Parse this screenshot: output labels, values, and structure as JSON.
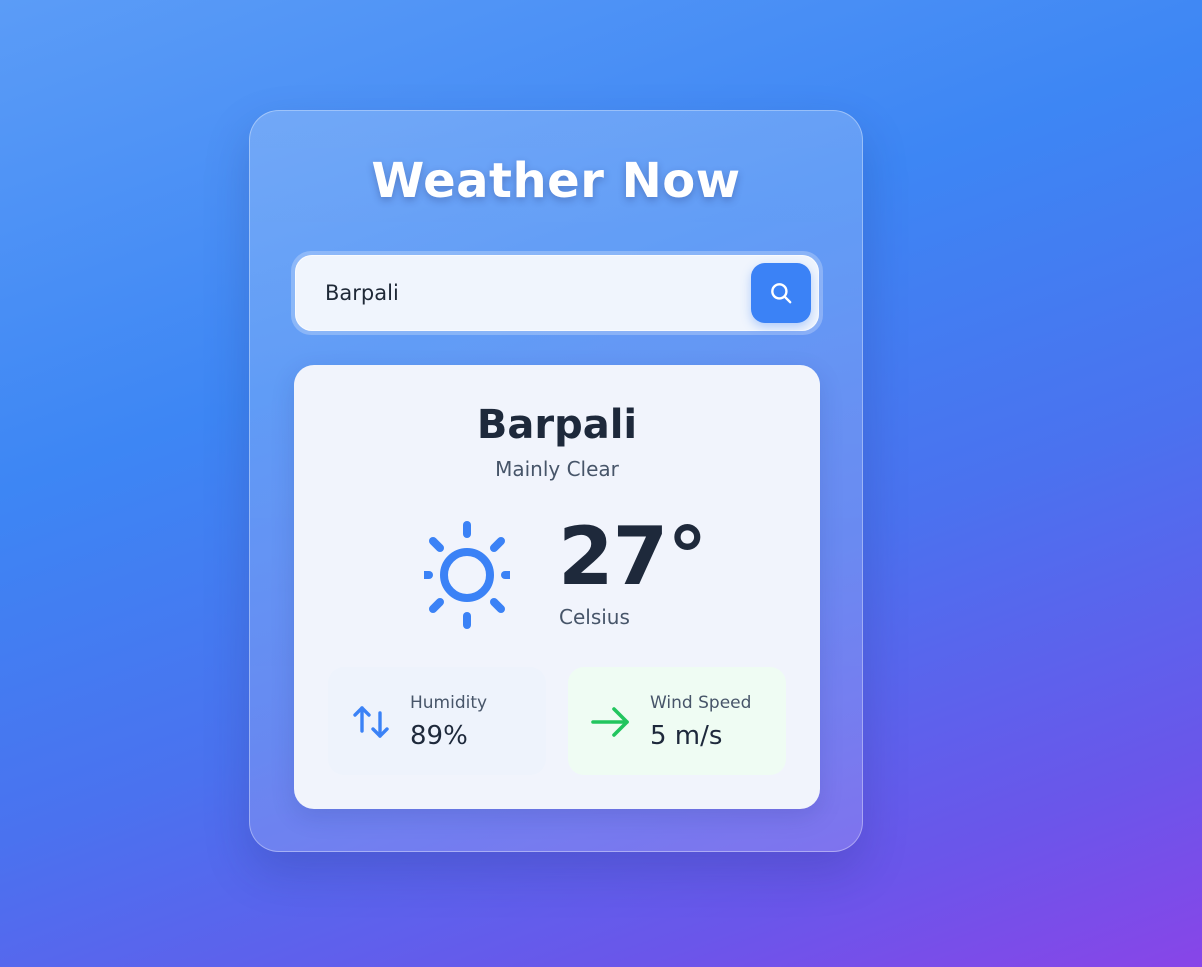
{
  "app": {
    "title": "Weather Now"
  },
  "search": {
    "value": "Barpali",
    "button_icon": "search-icon"
  },
  "weather": {
    "city": "Barpali",
    "condition": "Mainly Clear",
    "condition_icon": "sun-icon",
    "temperature": "27°",
    "unit": "Celsius"
  },
  "stats": {
    "humidity": {
      "label": "Humidity",
      "value": "89%",
      "icon": "arrows-up-down-icon"
    },
    "wind": {
      "label": "Wind Speed",
      "value": "5 m/s",
      "icon": "arrow-right-icon"
    }
  },
  "colors": {
    "accent": "#3b82f6",
    "wind_accent": "#22c55e",
    "text_dark": "#1e293b",
    "text_muted": "#475569"
  }
}
